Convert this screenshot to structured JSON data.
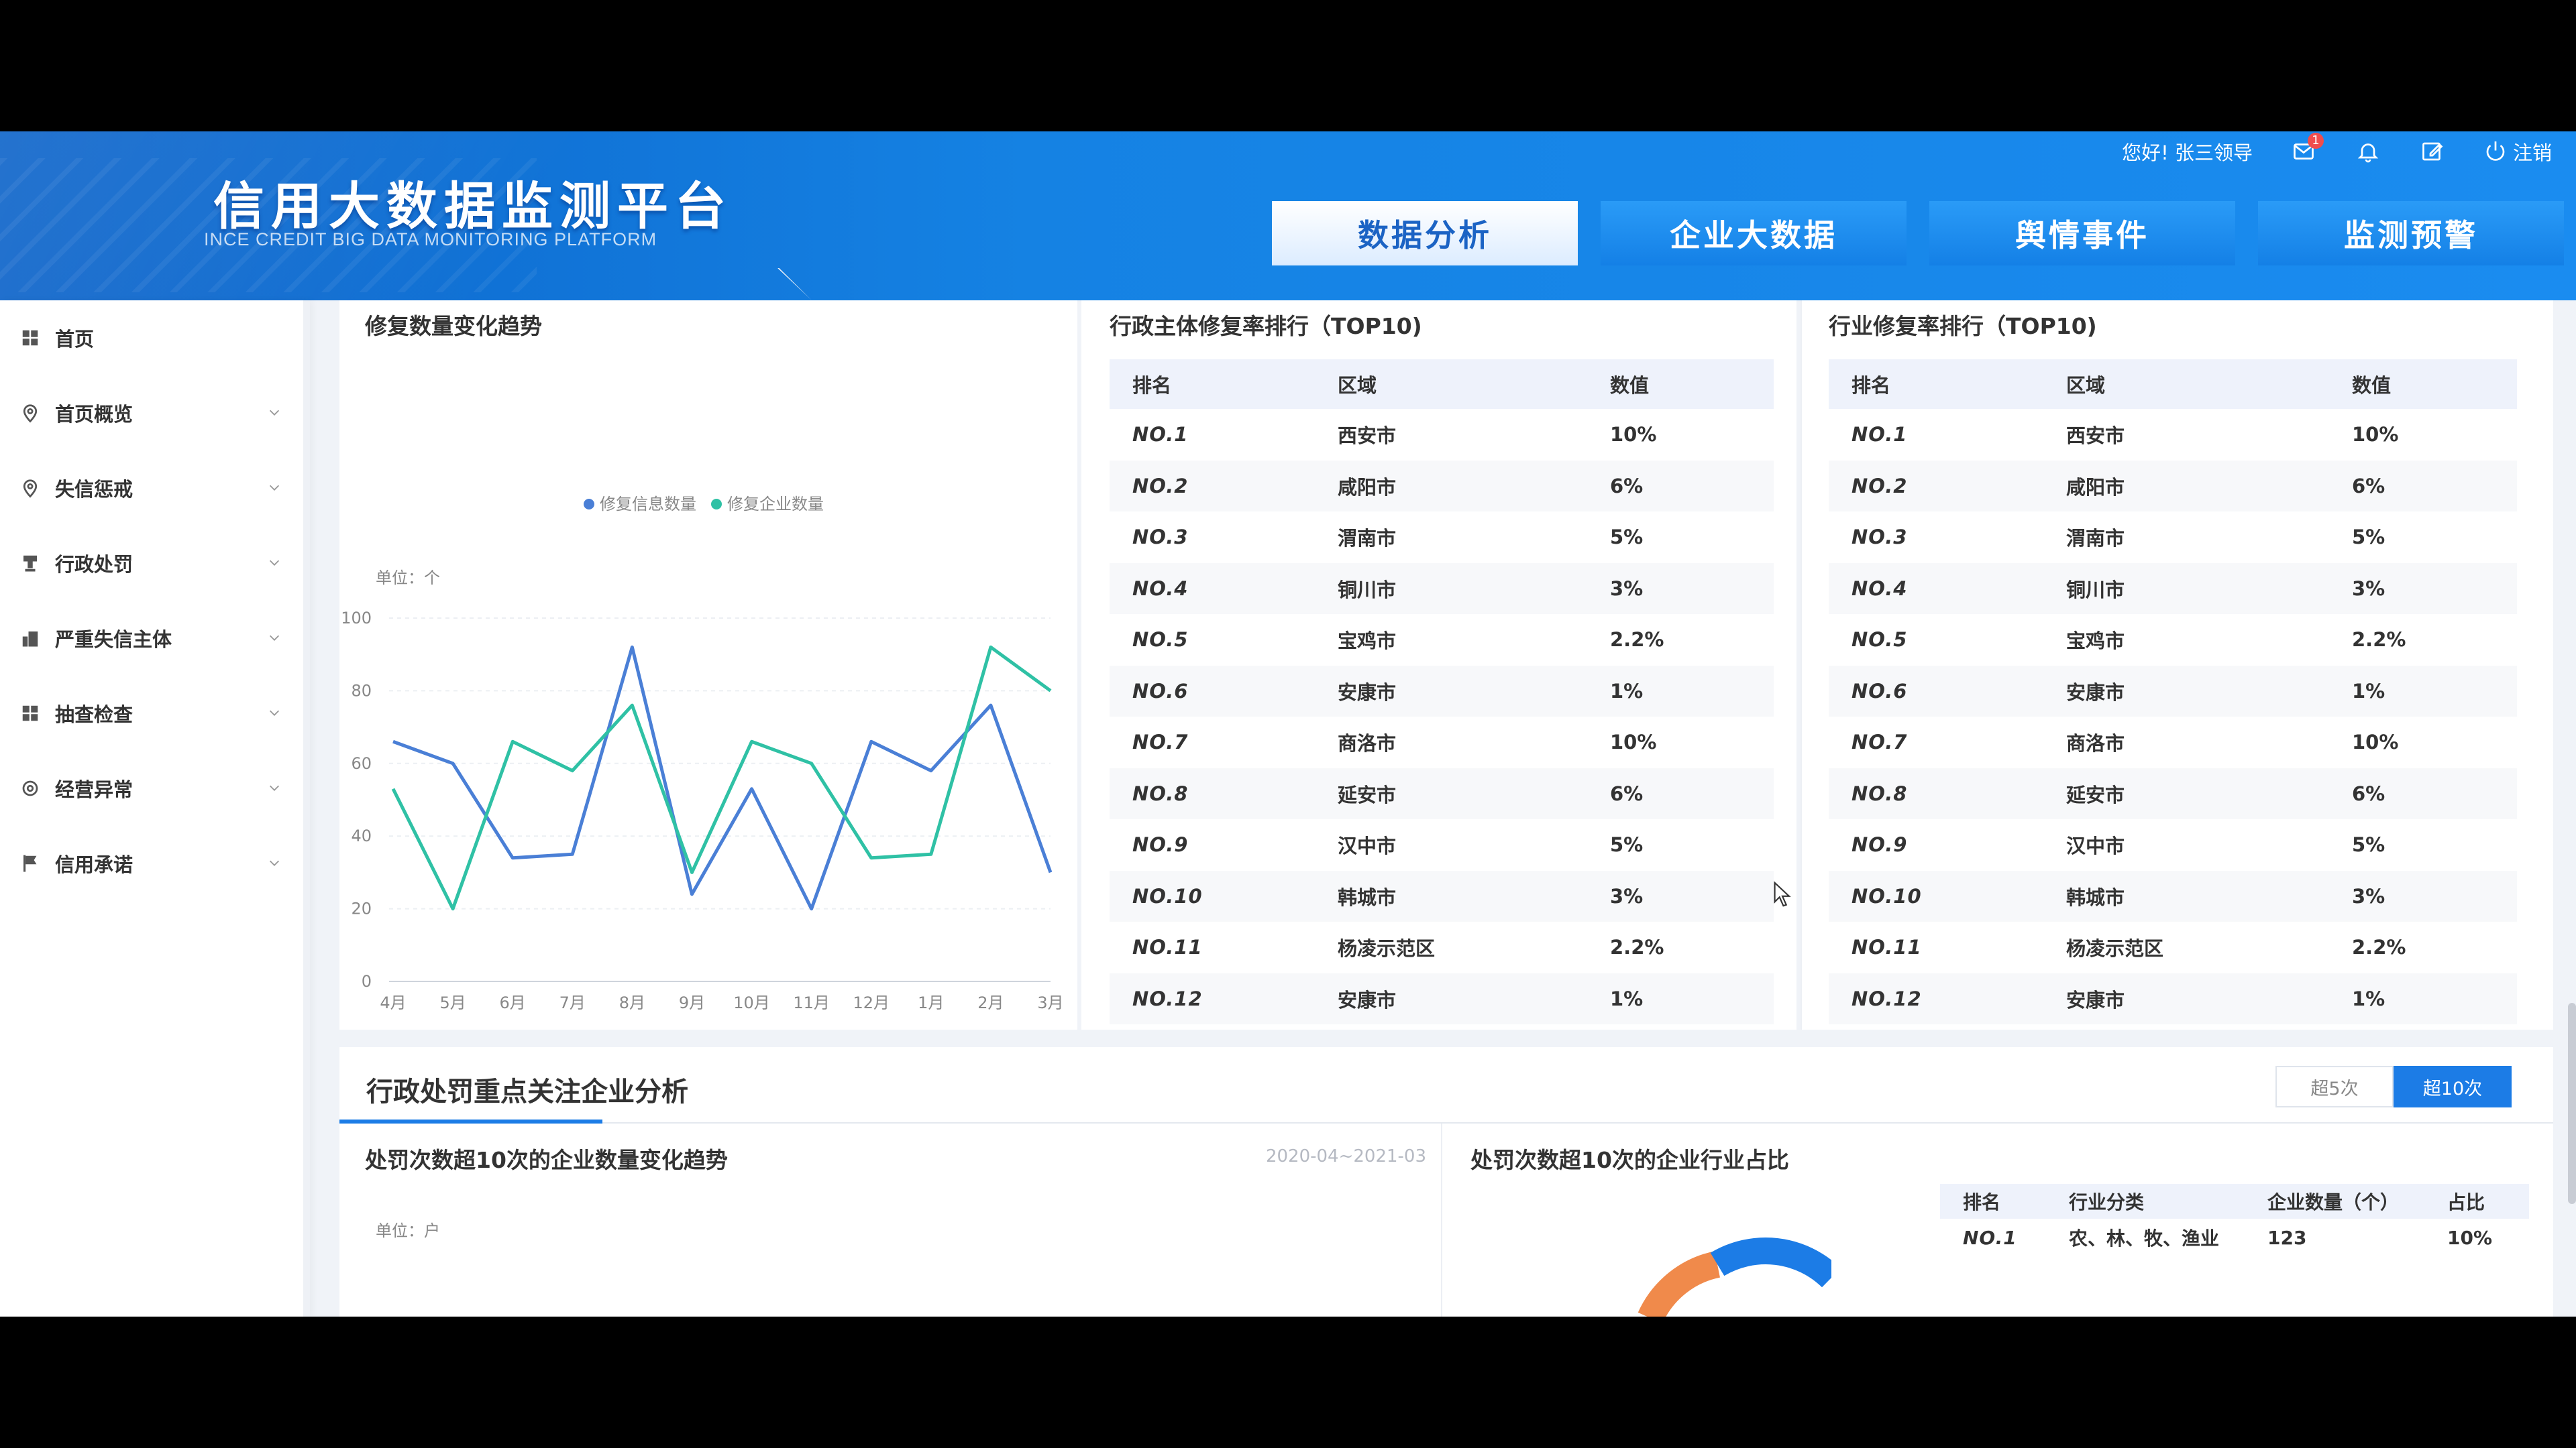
{
  "header": {
    "title": "信用大数据监测平台",
    "subtitle": "INCE CREDIT BIG DATA MONITORING PLATFORM",
    "greeting": "您好! 张三领导",
    "mail_badge": "1",
    "logout": "注销",
    "nav": [
      {
        "label": "数据分析",
        "active": true
      },
      {
        "label": "企业大数据",
        "active": false
      },
      {
        "label": "舆情事件",
        "active": false
      },
      {
        "label": "监测预警",
        "active": false
      }
    ]
  },
  "sidebar": {
    "items": [
      {
        "label": "首页",
        "icon": "grid-icon",
        "has_chevron": false
      },
      {
        "label": "首页概览",
        "icon": "location-pin-icon",
        "has_chevron": true
      },
      {
        "label": "失信惩戒",
        "icon": "location-pin-icon",
        "has_chevron": true
      },
      {
        "label": "行政处罚",
        "icon": "gavel-icon",
        "has_chevron": true
      },
      {
        "label": "严重失信主体",
        "icon": "building-icon",
        "has_chevron": true
      },
      {
        "label": "抽查检查",
        "icon": "grid-icon",
        "has_chevron": true
      },
      {
        "label": "经营异常",
        "icon": "gear-icon",
        "has_chevron": true
      },
      {
        "label": "信用承诺",
        "icon": "flag-icon",
        "has_chevron": true
      }
    ]
  },
  "trend_panel": {
    "title": "修复数量变化趋势",
    "unit": "单位：个"
  },
  "chart_data": {
    "type": "line",
    "categories": [
      "4月",
      "5月",
      "6月",
      "7月",
      "8月",
      "9月",
      "10月",
      "11月",
      "12月",
      "1月",
      "2月",
      "3月"
    ],
    "ylim": [
      0,
      100
    ],
    "yticks": [
      0,
      20,
      40,
      60,
      80,
      100
    ],
    "legend_position": "top-center",
    "grid": true,
    "series": [
      {
        "name": "修复信息数量",
        "color": "#4a7fd6",
        "values": [
          66,
          60,
          34,
          35,
          92,
          24,
          53,
          20,
          66,
          58,
          76,
          30
        ]
      },
      {
        "name": "修复企业数量",
        "color": "#2fc1a5",
        "values": [
          53,
          20,
          66,
          58,
          76,
          30,
          66,
          60,
          34,
          35,
          92,
          80
        ]
      }
    ]
  },
  "admin_rank": {
    "title": "行政主体修复率排行（TOP10)",
    "columns": [
      "排名",
      "区域",
      "数值"
    ],
    "rows": [
      {
        "rank": "NO.1",
        "region": "西安市",
        "value": "10%"
      },
      {
        "rank": "NO.2",
        "region": "咸阳市",
        "value": "6%"
      },
      {
        "rank": "NO.3",
        "region": "渭南市",
        "value": "5%"
      },
      {
        "rank": "NO.4",
        "region": "铜川市",
        "value": "3%"
      },
      {
        "rank": "NO.5",
        "region": "宝鸡市",
        "value": "2.2%"
      },
      {
        "rank": "NO.6",
        "region": "安康市",
        "value": "1%"
      },
      {
        "rank": "NO.7",
        "region": "商洛市",
        "value": "10%"
      },
      {
        "rank": "NO.8",
        "region": "延安市",
        "value": "6%"
      },
      {
        "rank": "NO.9",
        "region": "汉中市",
        "value": "5%"
      },
      {
        "rank": "NO.10",
        "region": "韩城市",
        "value": "3%"
      },
      {
        "rank": "NO.11",
        "region": "杨凌示范区",
        "value": "2.2%"
      },
      {
        "rank": "NO.12",
        "region": "安康市",
        "value": "1%"
      }
    ]
  },
  "industry_rank": {
    "title": "行业修复率排行（TOP10)",
    "columns": [
      "排名",
      "区域",
      "数值"
    ],
    "rows": [
      {
        "rank": "NO.1",
        "region": "西安市",
        "value": "10%"
      },
      {
        "rank": "NO.2",
        "region": "咸阳市",
        "value": "6%"
      },
      {
        "rank": "NO.3",
        "region": "渭南市",
        "value": "5%"
      },
      {
        "rank": "NO.4",
        "region": "铜川市",
        "value": "3%"
      },
      {
        "rank": "NO.5",
        "region": "宝鸡市",
        "value": "2.2%"
      },
      {
        "rank": "NO.6",
        "region": "安康市",
        "value": "1%"
      },
      {
        "rank": "NO.7",
        "region": "商洛市",
        "value": "10%"
      },
      {
        "rank": "NO.8",
        "region": "延安市",
        "value": "6%"
      },
      {
        "rank": "NO.9",
        "region": "汉中市",
        "value": "5%"
      },
      {
        "rank": "NO.10",
        "region": "韩城市",
        "value": "3%"
      },
      {
        "rank": "NO.11",
        "region": "杨凌示范区",
        "value": "2.2%"
      },
      {
        "rank": "NO.12",
        "region": "安康市",
        "value": "1%"
      }
    ]
  },
  "lower": {
    "title": "行政处罚重点关注企业分析",
    "toggle": [
      {
        "label": "超5次",
        "active": false
      },
      {
        "label": "超10次",
        "active": true
      }
    ],
    "left_title": "处罚次数超10次的企业数量变化趋势",
    "left_date": "2020-04~2021-03",
    "left_unit": "单位：户",
    "right_title": "处罚次数超10次的企业行业占比",
    "table_columns": [
      "排名",
      "行业分类",
      "企业数量（个）",
      "占比"
    ],
    "table_rows": [
      {
        "rank": "NO.1",
        "industry": "农、林、牧、渔业",
        "count": "123",
        "ratio": "10%"
      }
    ]
  }
}
